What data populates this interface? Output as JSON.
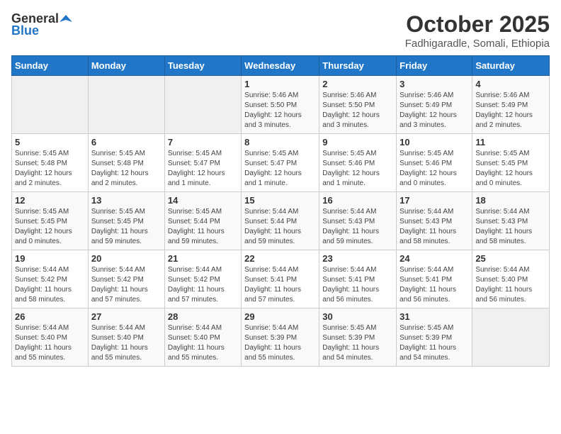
{
  "header": {
    "logo_general": "General",
    "logo_blue": "Blue",
    "month_title": "October 2025",
    "location": "Fadhigaradle, Somali, Ethiopia"
  },
  "weekdays": [
    "Sunday",
    "Monday",
    "Tuesday",
    "Wednesday",
    "Thursday",
    "Friday",
    "Saturday"
  ],
  "weeks": [
    [
      {
        "day": "",
        "info": ""
      },
      {
        "day": "",
        "info": ""
      },
      {
        "day": "",
        "info": ""
      },
      {
        "day": "1",
        "info": "Sunrise: 5:46 AM\nSunset: 5:50 PM\nDaylight: 12 hours\nand 3 minutes."
      },
      {
        "day": "2",
        "info": "Sunrise: 5:46 AM\nSunset: 5:50 PM\nDaylight: 12 hours\nand 3 minutes."
      },
      {
        "day": "3",
        "info": "Sunrise: 5:46 AM\nSunset: 5:49 PM\nDaylight: 12 hours\nand 3 minutes."
      },
      {
        "day": "4",
        "info": "Sunrise: 5:46 AM\nSunset: 5:49 PM\nDaylight: 12 hours\nand 2 minutes."
      }
    ],
    [
      {
        "day": "5",
        "info": "Sunrise: 5:45 AM\nSunset: 5:48 PM\nDaylight: 12 hours\nand 2 minutes."
      },
      {
        "day": "6",
        "info": "Sunrise: 5:45 AM\nSunset: 5:48 PM\nDaylight: 12 hours\nand 2 minutes."
      },
      {
        "day": "7",
        "info": "Sunrise: 5:45 AM\nSunset: 5:47 PM\nDaylight: 12 hours\nand 1 minute."
      },
      {
        "day": "8",
        "info": "Sunrise: 5:45 AM\nSunset: 5:47 PM\nDaylight: 12 hours\nand 1 minute."
      },
      {
        "day": "9",
        "info": "Sunrise: 5:45 AM\nSunset: 5:46 PM\nDaylight: 12 hours\nand 1 minute."
      },
      {
        "day": "10",
        "info": "Sunrise: 5:45 AM\nSunset: 5:46 PM\nDaylight: 12 hours\nand 0 minutes."
      },
      {
        "day": "11",
        "info": "Sunrise: 5:45 AM\nSunset: 5:45 PM\nDaylight: 12 hours\nand 0 minutes."
      }
    ],
    [
      {
        "day": "12",
        "info": "Sunrise: 5:45 AM\nSunset: 5:45 PM\nDaylight: 12 hours\nand 0 minutes."
      },
      {
        "day": "13",
        "info": "Sunrise: 5:45 AM\nSunset: 5:45 PM\nDaylight: 11 hours\nand 59 minutes."
      },
      {
        "day": "14",
        "info": "Sunrise: 5:45 AM\nSunset: 5:44 PM\nDaylight: 11 hours\nand 59 minutes."
      },
      {
        "day": "15",
        "info": "Sunrise: 5:44 AM\nSunset: 5:44 PM\nDaylight: 11 hours\nand 59 minutes."
      },
      {
        "day": "16",
        "info": "Sunrise: 5:44 AM\nSunset: 5:43 PM\nDaylight: 11 hours\nand 59 minutes."
      },
      {
        "day": "17",
        "info": "Sunrise: 5:44 AM\nSunset: 5:43 PM\nDaylight: 11 hours\nand 58 minutes."
      },
      {
        "day": "18",
        "info": "Sunrise: 5:44 AM\nSunset: 5:43 PM\nDaylight: 11 hours\nand 58 minutes."
      }
    ],
    [
      {
        "day": "19",
        "info": "Sunrise: 5:44 AM\nSunset: 5:42 PM\nDaylight: 11 hours\nand 58 minutes."
      },
      {
        "day": "20",
        "info": "Sunrise: 5:44 AM\nSunset: 5:42 PM\nDaylight: 11 hours\nand 57 minutes."
      },
      {
        "day": "21",
        "info": "Sunrise: 5:44 AM\nSunset: 5:42 PM\nDaylight: 11 hours\nand 57 minutes."
      },
      {
        "day": "22",
        "info": "Sunrise: 5:44 AM\nSunset: 5:41 PM\nDaylight: 11 hours\nand 57 minutes."
      },
      {
        "day": "23",
        "info": "Sunrise: 5:44 AM\nSunset: 5:41 PM\nDaylight: 11 hours\nand 56 minutes."
      },
      {
        "day": "24",
        "info": "Sunrise: 5:44 AM\nSunset: 5:41 PM\nDaylight: 11 hours\nand 56 minutes."
      },
      {
        "day": "25",
        "info": "Sunrise: 5:44 AM\nSunset: 5:40 PM\nDaylight: 11 hours\nand 56 minutes."
      }
    ],
    [
      {
        "day": "26",
        "info": "Sunrise: 5:44 AM\nSunset: 5:40 PM\nDaylight: 11 hours\nand 55 minutes."
      },
      {
        "day": "27",
        "info": "Sunrise: 5:44 AM\nSunset: 5:40 PM\nDaylight: 11 hours\nand 55 minutes."
      },
      {
        "day": "28",
        "info": "Sunrise: 5:44 AM\nSunset: 5:40 PM\nDaylight: 11 hours\nand 55 minutes."
      },
      {
        "day": "29",
        "info": "Sunrise: 5:44 AM\nSunset: 5:39 PM\nDaylight: 11 hours\nand 55 minutes."
      },
      {
        "day": "30",
        "info": "Sunrise: 5:45 AM\nSunset: 5:39 PM\nDaylight: 11 hours\nand 54 minutes."
      },
      {
        "day": "31",
        "info": "Sunrise: 5:45 AM\nSunset: 5:39 PM\nDaylight: 11 hours\nand 54 minutes."
      },
      {
        "day": "",
        "info": ""
      }
    ]
  ]
}
